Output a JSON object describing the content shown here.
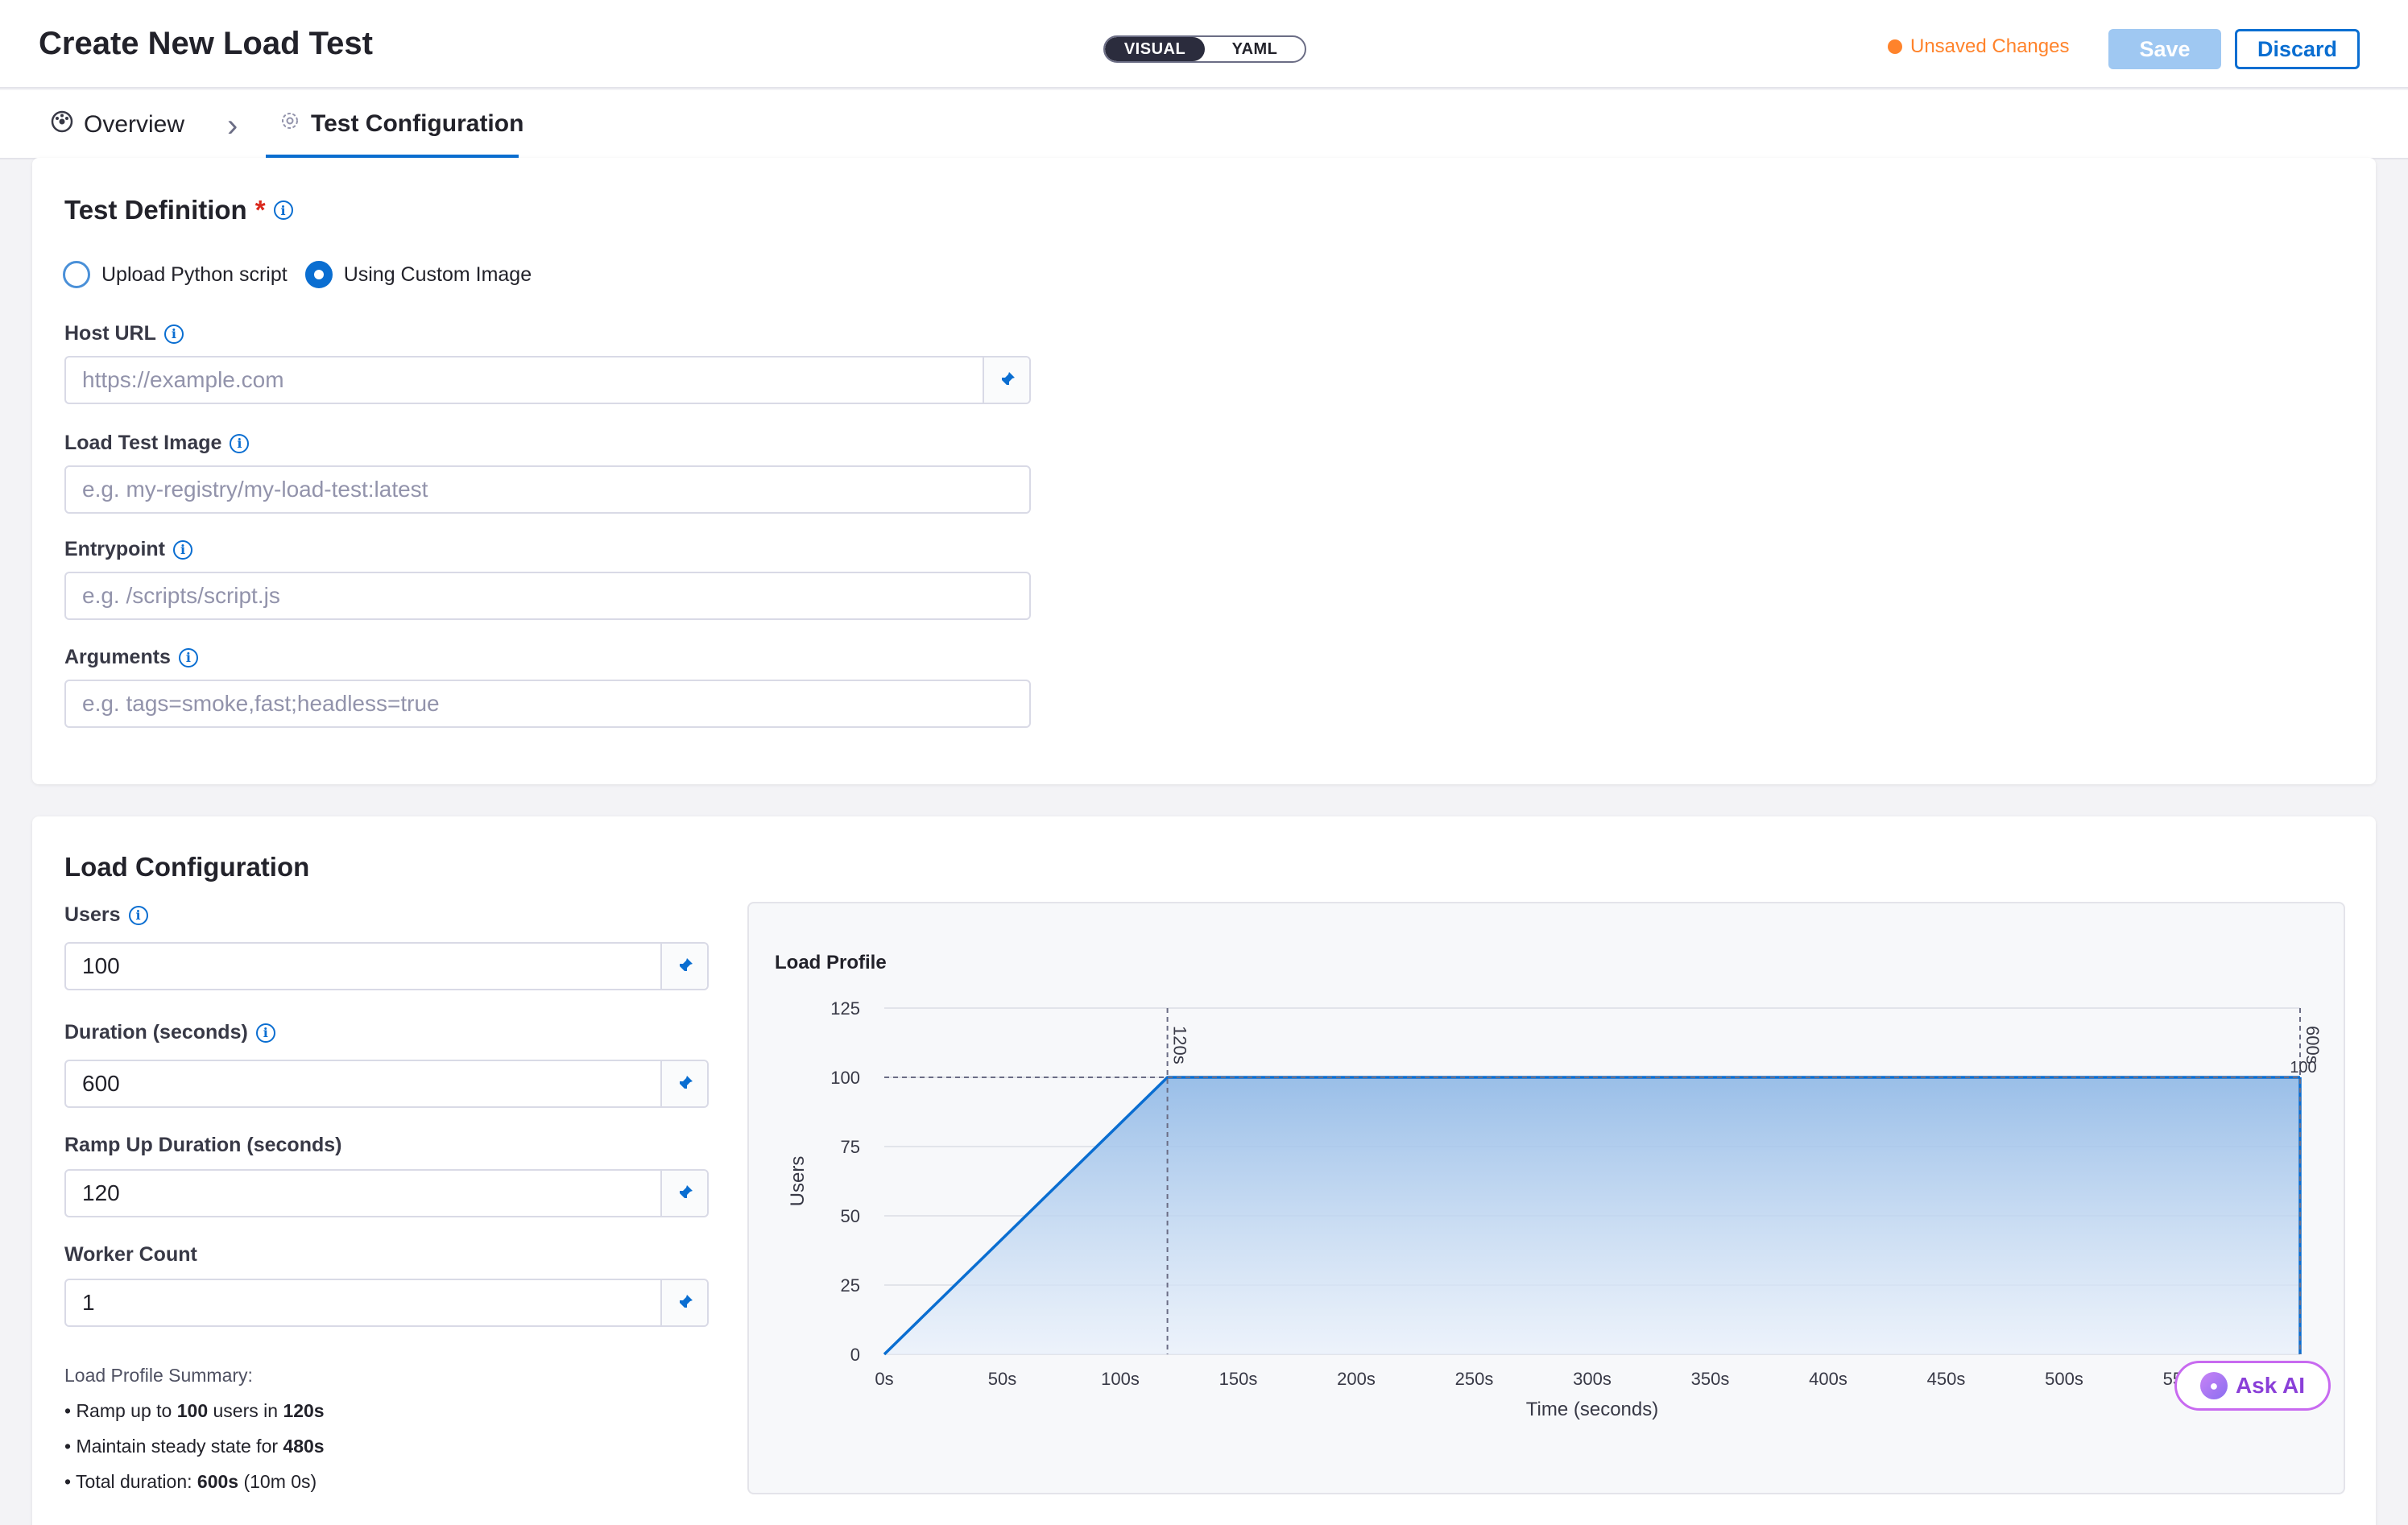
{
  "header": {
    "title": "Create New Load Test",
    "toggle": {
      "visual": "VISUAL",
      "yaml": "YAML",
      "active": "VISUAL"
    },
    "unsaved": "Unsaved Changes",
    "save_label": "Save",
    "discard_label": "Discard"
  },
  "tabs": {
    "overview": "Overview",
    "config": "Test Configuration"
  },
  "test_definition": {
    "title": "Test Definition",
    "required_mark": "*",
    "radio_python": "Upload Python script",
    "radio_image": "Using Custom Image",
    "selected": "Using Custom Image",
    "host_url_label": "Host URL",
    "host_url_placeholder": "https://example.com",
    "image_label": "Load Test Image",
    "image_placeholder": "e.g. my-registry/my-load-test:latest",
    "entrypoint_label": "Entrypoint",
    "entrypoint_placeholder": "e.g. /scripts/script.js",
    "arguments_label": "Arguments",
    "arguments_placeholder": "e.g. tags=smoke,fast;headless=true"
  },
  "load_config": {
    "title": "Load Configuration",
    "users_label": "Users",
    "users_value": "100",
    "duration_label": "Duration (seconds)",
    "duration_value": "600",
    "ramp_label": "Ramp Up Duration (seconds)",
    "ramp_value": "120",
    "workers_label": "Worker Count",
    "workers_value": "1",
    "summary_title": "Load Profile Summary:",
    "summary": {
      "line1_pre": "• Ramp up to ",
      "line1_users": "100",
      "line1_mid": " users in ",
      "line1_time": "120s",
      "line2_pre": "• Maintain steady state for ",
      "line2_time": "480s",
      "line3_pre": "• Total duration: ",
      "line3_time": "600s",
      "line3_post": " (10m 0s)"
    }
  },
  "ask_ai": "Ask AI",
  "colors": {
    "accent": "#0a6ed1",
    "unsaved": "#ff832b",
    "area_top": "#8fb8e6",
    "area_bottom": "#e8f0fb"
  },
  "chart_data": {
    "type": "area",
    "title": "Load Profile",
    "xlabel": "Time (seconds)",
    "ylabel": "Users",
    "x_ticks": [
      "0s",
      "50s",
      "100s",
      "150s",
      "200s",
      "250s",
      "300s",
      "350s",
      "400s",
      "450s",
      "500s",
      "550s"
    ],
    "y_ticks": [
      "0",
      "25",
      "50",
      "75",
      "100",
      "125"
    ],
    "xlim": [
      0,
      600
    ],
    "ylim": [
      0,
      125
    ],
    "x": [
      0,
      120,
      600
    ],
    "values": [
      0,
      100,
      100
    ],
    "annotations": [
      {
        "x": 120,
        "label": "120s"
      },
      {
        "x": 600,
        "label": "600s"
      },
      {
        "y": 100,
        "label": "100"
      }
    ],
    "grid": true
  }
}
